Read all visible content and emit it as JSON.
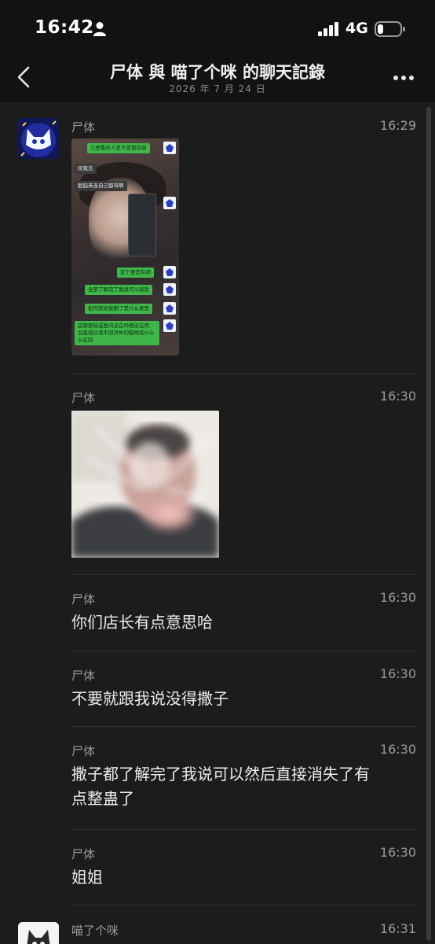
{
  "status_bar": {
    "time": "16:42",
    "network": "4G"
  },
  "nav": {
    "title": "尸体 與 喵了个咪 的聊天記錄",
    "subtitle": "2026 年 7 月 24 日"
  },
  "messages": [
    {
      "sender": "尸体",
      "time": "16:29",
      "type": "image"
    },
    {
      "sender": "尸体",
      "time": "16:30",
      "type": "image"
    },
    {
      "sender": "尸体",
      "time": "16:30",
      "text": "你们店长有点意思哈"
    },
    {
      "sender": "尸体",
      "time": "16:30",
      "text": "不要就跟我说没得撒子"
    },
    {
      "sender": "尸体",
      "time": "16:30",
      "text_line1": "撒子都了解完了我说可以然后直接消失了有",
      "text_line2": "点整蛊了"
    },
    {
      "sender": "尸体",
      "time": "16:30",
      "text": "姐姐"
    },
    {
      "sender": "喵了个咪",
      "time": "16:31"
    }
  ],
  "screenshot": {
    "b1": "几把重庆人是不是都有病",
    "b2": "叹我去",
    "b3": "狠起来连自己都骂啊",
    "b4": "这个更是有病",
    "b5": "全部了解完了我说可以接受",
    "b6": "如何就给我删了是什么意思",
    "b7_line1": "这跟那些咸鱼问还在吗嗯还在然",
    "b7_line2": "后直接已读不回消失的脑残有什么",
    "b7_line3": "么区别"
  },
  "colors": {
    "background": "#1c1c1c",
    "bar": "#121212",
    "bubble_green": "#3fb64a"
  }
}
